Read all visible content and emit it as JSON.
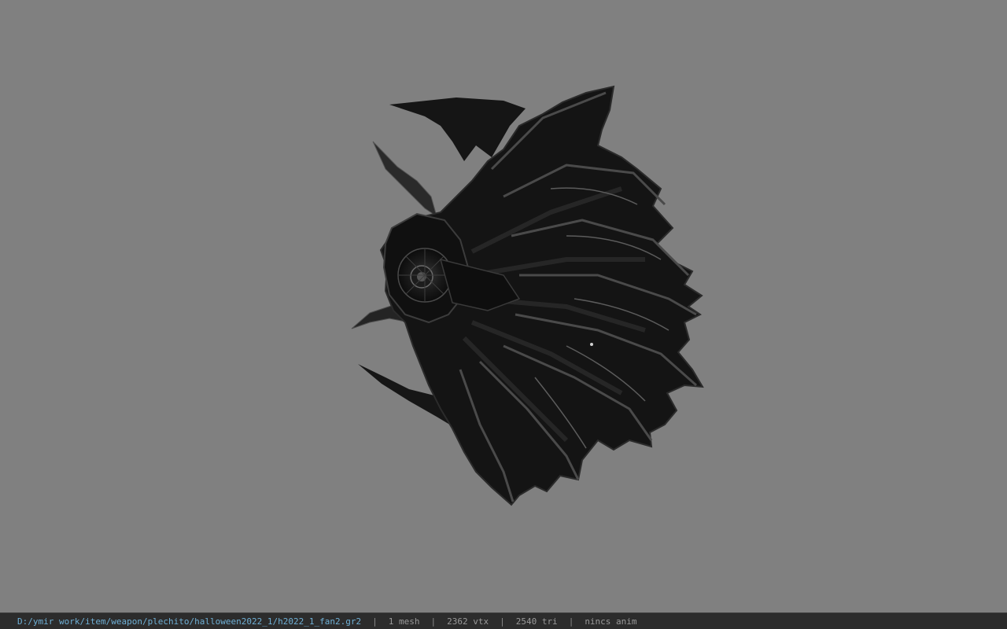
{
  "viewport": {
    "background_color": "#808080",
    "model_icon": "fan-weapon-model"
  },
  "status_bar": {
    "file_path": "D:/ymir work/item/weapon/plechito/halloween2022_1/h2022_1_fan2.gr2",
    "separator": "|",
    "mesh_count": "1 mesh",
    "vertex_count": "2362 vtx",
    "triangle_count": "2540 tri",
    "anim_status": "nincs anim",
    "path_color": "#6fb0d6",
    "text_color": "#9a9a9a"
  }
}
